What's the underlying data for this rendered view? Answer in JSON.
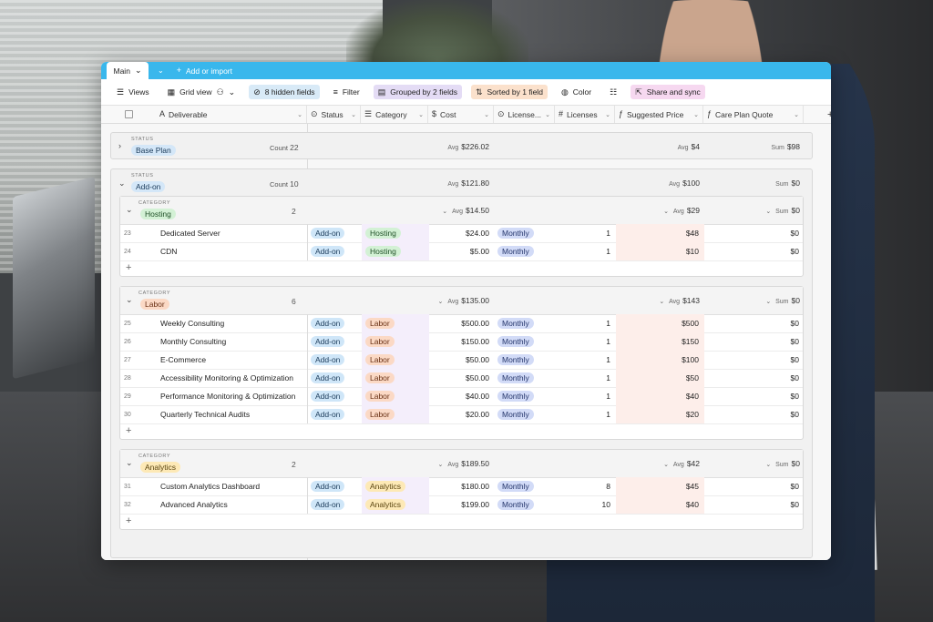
{
  "tabbar": {
    "main_tab": "Main",
    "add_import": "Add or import"
  },
  "toolbar": {
    "views": "Views",
    "grid_view": "Grid view",
    "hidden_fields": "8 hidden fields",
    "filter": "Filter",
    "grouped": "Grouped by 2 fields",
    "sorted": "Sorted by 1 field",
    "color": "Color",
    "share": "Share and sync"
  },
  "columns": [
    "Deliverable",
    "Status",
    "Category",
    "Cost",
    "License...",
    "Licenses",
    "Suggested Price",
    "Care Plan Quote"
  ],
  "groups": {
    "base_plan": {
      "label": "STATUS",
      "name": "Base Plan",
      "count_label": "Count",
      "count": "22",
      "cost_avg": "$226.02",
      "price_avg": "$4",
      "quote_sum": "$98"
    },
    "addon": {
      "label": "STATUS",
      "name": "Add-on",
      "count_label": "Count",
      "count": "10",
      "cost_avg": "$121.80",
      "price_avg": "$100",
      "quote_sum": "$0"
    }
  },
  "subgroups": [
    {
      "label": "CATEGORY",
      "name": "Hosting",
      "count": "2",
      "cost_avg": "$14.50",
      "price_avg": "$29",
      "quote_sum": "$0",
      "rows": [
        {
          "n": "23",
          "deliverable": "Dedicated Server",
          "status": "Add-on",
          "category": "Hosting",
          "cost": "$24.00",
          "license": "Monthly",
          "licenses": "1",
          "price": "$48",
          "quote": "$0"
        },
        {
          "n": "24",
          "deliverable": "CDN",
          "status": "Add-on",
          "category": "Hosting",
          "cost": "$5.00",
          "license": "Monthly",
          "licenses": "1",
          "price": "$10",
          "quote": "$0"
        }
      ]
    },
    {
      "label": "CATEGORY",
      "name": "Labor",
      "count": "6",
      "cost_avg": "$135.00",
      "price_avg": "$143",
      "quote_sum": "$0",
      "rows": [
        {
          "n": "25",
          "deliverable": "Weekly Consulting",
          "status": "Add-on",
          "category": "Labor",
          "cost": "$500.00",
          "license": "Monthly",
          "licenses": "1",
          "price": "$500",
          "quote": "$0"
        },
        {
          "n": "26",
          "deliverable": "Monthly Consulting",
          "status": "Add-on",
          "category": "Labor",
          "cost": "$150.00",
          "license": "Monthly",
          "licenses": "1",
          "price": "$150",
          "quote": "$0"
        },
        {
          "n": "27",
          "deliverable": "E-Commerce",
          "status": "Add-on",
          "category": "Labor",
          "cost": "$50.00",
          "license": "Monthly",
          "licenses": "1",
          "price": "$100",
          "quote": "$0"
        },
        {
          "n": "28",
          "deliverable": "Accessibility Monitoring & Optimization",
          "status": "Add-on",
          "category": "Labor",
          "cost": "$50.00",
          "license": "Monthly",
          "licenses": "1",
          "price": "$50",
          "quote": "$0"
        },
        {
          "n": "29",
          "deliverable": "Performance Monitoring & Optimization",
          "status": "Add-on",
          "category": "Labor",
          "cost": "$40.00",
          "license": "Monthly",
          "licenses": "1",
          "price": "$40",
          "quote": "$0"
        },
        {
          "n": "30",
          "deliverable": "Quarterly Technical Audits",
          "status": "Add-on",
          "category": "Labor",
          "cost": "$20.00",
          "license": "Monthly",
          "licenses": "1",
          "price": "$20",
          "quote": "$0"
        }
      ]
    },
    {
      "label": "CATEGORY",
      "name": "Analytics",
      "count": "2",
      "cost_avg": "$189.50",
      "price_avg": "$42",
      "quote_sum": "$0",
      "rows": [
        {
          "n": "31",
          "deliverable": "Custom Analytics Dashboard",
          "status": "Add-on",
          "category": "Analytics",
          "cost": "$180.00",
          "license": "Monthly",
          "licenses": "8",
          "price": "$45",
          "quote": "$0"
        },
        {
          "n": "32",
          "deliverable": "Advanced Analytics",
          "status": "Add-on",
          "category": "Analytics",
          "cost": "$199.00",
          "license": "Monthly",
          "licenses": "10",
          "price": "$40",
          "quote": "$0"
        }
      ]
    }
  ],
  "agg": {
    "avg": "Avg",
    "sum": "Sum"
  },
  "add_row": "+"
}
